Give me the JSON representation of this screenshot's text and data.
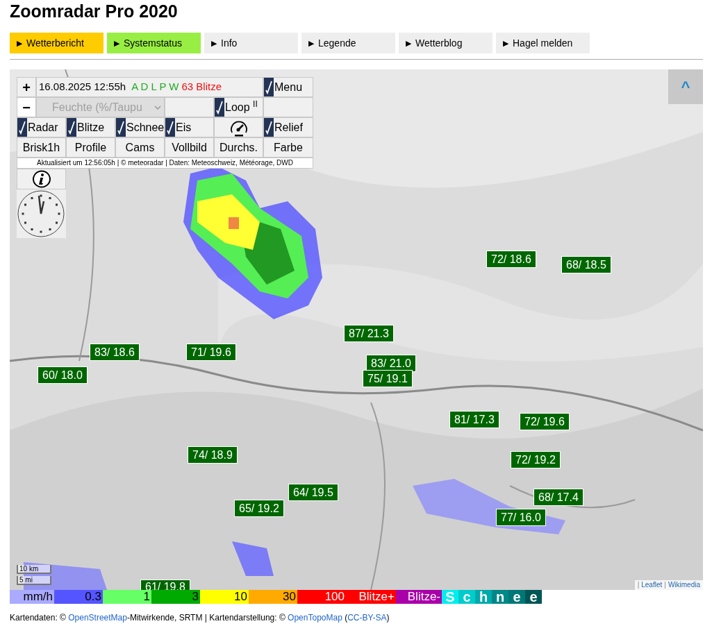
{
  "title": "Zoomradar Pro 2020",
  "tabs": [
    {
      "label": "Wetterbericht",
      "icon": "▶",
      "color": "#ffcc00"
    },
    {
      "label": "Systemstatus",
      "icon": "▶",
      "color": "#99ee44"
    },
    {
      "label": "Info",
      "icon": "▶",
      "color": "#eeeeee"
    },
    {
      "label": "Legende",
      "icon": "▶",
      "color": "#eeeeee"
    },
    {
      "label": "Wetterblog",
      "icon": "▶",
      "color": "#eeeeee"
    },
    {
      "label": "Hagel melden",
      "icon": "▶",
      "color": "#eeeeee"
    }
  ],
  "panel": {
    "zoom_in": "+",
    "zoom_out": "−",
    "timestamp": "16.08.2025 12:55h",
    "sources": "A D L P W",
    "lightning": "63 Blitze",
    "menu": {
      "label": "Menu",
      "checked": true
    },
    "layer_select": {
      "value": "Feuchte (%/Taupu",
      "disabled": true
    },
    "loop": {
      "label": "Loop $^{II}$",
      "checked": true
    },
    "toggles": [
      {
        "label": "Radar",
        "checked": true
      },
      {
        "label": "Blitze",
        "checked": true
      },
      {
        "label": "Schnee",
        "checked": true
      },
      {
        "label": "Eis",
        "checked": true
      },
      {
        "label": "Relief",
        "checked": true
      }
    ],
    "buttons": [
      "Brisk1h",
      "Profile",
      "Cams",
      "Vollbild",
      "Durchs.",
      "Farbe"
    ],
    "updated": "Aktualisiert um 12:56:05h | © meteoradar | Daten: Meteoschweiz, Météorage, DWD"
  },
  "collapse_button": "^",
  "stations": [
    "72/ 18.6",
    "68/ 18.5",
    "87/ 21.3",
    "83/ 18.6",
    "71/ 19.6",
    "83/ 21.0",
    "60/ 18.0",
    "75/ 19.1",
    "81/ 17.3",
    "72/ 19.6",
    "74/ 18.9",
    "72/ 19.2",
    "64/ 19.5",
    "68/ 17.4",
    "65/ 19.2",
    "77/ 16.0",
    "61/ 19.8"
  ],
  "scale": [
    "10 km",
    "5 mi"
  ],
  "attribution": {
    "separator": "|",
    "links": [
      "Leaflet",
      "Wikimedia"
    ]
  },
  "legend": [
    {
      "label": "mm/h",
      "color": "#aaaaff"
    },
    {
      "label": "0.3",
      "color": "#5555ff"
    },
    {
      "label": "1",
      "color": "#66ff66"
    },
    {
      "label": "3",
      "color": "#00aa00"
    },
    {
      "label": "10",
      "color": "#ffff00"
    },
    {
      "label": "30",
      "color": "#ffaa00"
    },
    {
      "label": "100",
      "color": "#ff0000"
    },
    {
      "label": "Blitze+",
      "color": "#ff0000"
    },
    {
      "label": "Blitze-",
      "color": "#aa00aa"
    },
    {
      "label": "S",
      "color": "#00eeee"
    },
    {
      "label": "c",
      "color": "#00cccc"
    },
    {
      "label": "h",
      "color": "#00aaaa"
    },
    {
      "label": "n",
      "color": "#008888"
    },
    {
      "label": "e",
      "color": "#007777"
    },
    {
      "label": "e",
      "color": "#005555"
    }
  ],
  "footer": [
    {
      "text": "Kartendaten: © ",
      "link": false
    },
    {
      "text": "OpenStreetMap",
      "link": true
    },
    {
      "text": "-Mitwirkende, SRTM | Kartendarstellung: © ",
      "link": false
    },
    {
      "text": "OpenTopoMap",
      "link": true
    },
    {
      "text": " (",
      "link": false
    },
    {
      "text": "CC-BY-SA",
      "link": true
    },
    {
      "text": ")",
      "link": false
    }
  ]
}
